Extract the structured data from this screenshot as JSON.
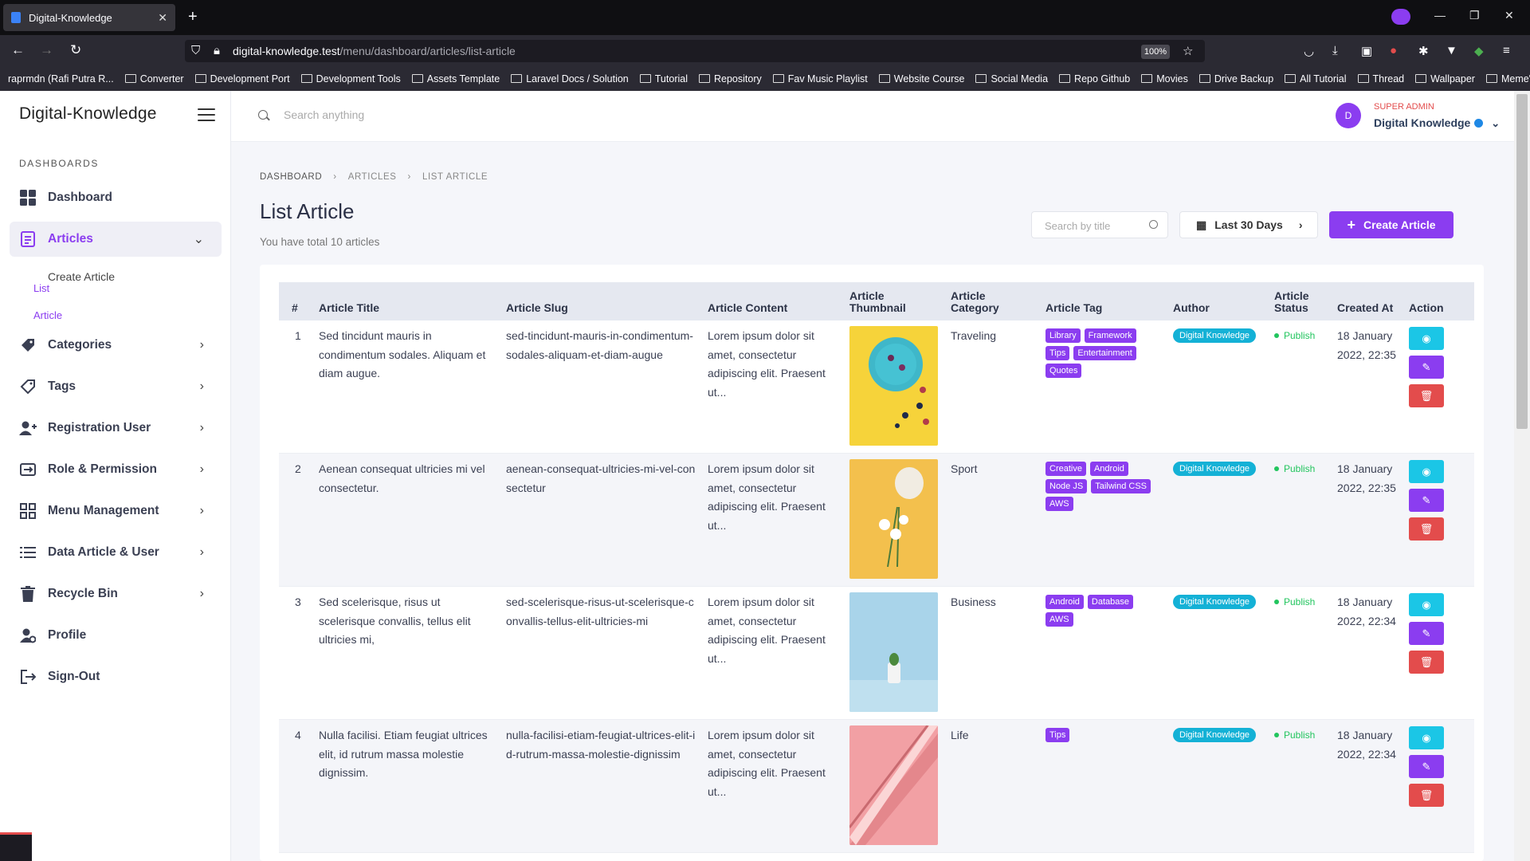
{
  "browser": {
    "tab_title": "Digital-Knowledge",
    "url_host": "digital-knowledge.test",
    "url_path": "/menu/dashboard/articles/list-article",
    "zoom": "100%",
    "bookmarks": [
      "raprmdn (Rafi Putra R...",
      "Converter",
      "Development Port",
      "Development Tools",
      "Assets Template",
      "Laravel Docs / Solution",
      "Tutorial",
      "Repository",
      "Fav Music Playlist",
      "Website Course",
      "Social Media",
      "Repo Github",
      "Movies",
      "Drive Backup",
      "All Tutorial",
      "Thread",
      "Wallpaper",
      "Meme's"
    ]
  },
  "sidebar": {
    "brand": "Digital-Knowledge",
    "section": "DASHBOARDS",
    "items": [
      {
        "label": "Dashboard"
      },
      {
        "label": "Articles",
        "sub": [
          "Create Article",
          "List Article"
        ]
      },
      {
        "label": "Categories"
      },
      {
        "label": "Tags"
      },
      {
        "label": "Registration User"
      },
      {
        "label": "Role & Permission"
      },
      {
        "label": "Menu Management"
      },
      {
        "label": "Data Article & User"
      },
      {
        "label": "Recycle Bin"
      },
      {
        "label": "Profile"
      },
      {
        "label": "Sign-Out"
      }
    ]
  },
  "topbar": {
    "search_placeholder": "Search anything",
    "avatar": "D",
    "role": "SUPER ADMIN",
    "user": "Digital Knowledge"
  },
  "page": {
    "breadcrumb": [
      "DASHBOARD",
      "ARTICLES",
      "LIST ARTICLE"
    ],
    "title": "List Article",
    "subtitle": "You have total 10 articles",
    "search_placeholder": "Search by title",
    "date_filter": "Last 30 Days",
    "create_label": "Create Article"
  },
  "table": {
    "headers": [
      "#",
      "Article Title",
      "Article Slug",
      "Article Content",
      "Article Thumbnail",
      "Article Category",
      "Article Tag",
      "Author",
      "Article Status",
      "Created At",
      "Action"
    ],
    "rows": [
      {
        "n": "1",
        "title": "Sed tincidunt mauris in condimentum sodales. Aliquam et diam augue.",
        "slug": "sed-tincidunt-mauris-in-condimentum-sodales-aliquam-et-diam-augue",
        "content": "Lorem ipsum dolor sit amet, consectetur adipiscing elit. Praesent ut...",
        "category": "Traveling",
        "tags": [
          "Library",
          "Framework",
          "Tips",
          "Entertainment",
          "Quotes"
        ],
        "author": "Digital Knowledge",
        "status": "Publish",
        "created": "18 January 2022, 22:35",
        "thumb": "yellow"
      },
      {
        "n": "2",
        "title": "Aenean consequat ultricies mi vel consectetur.",
        "slug": "aenean-consequat-ultricies-mi-vel-consectetur",
        "content": "Lorem ipsum dolor sit amet, consectetur adipiscing elit. Praesent ut...",
        "category": "Sport",
        "tags": [
          "Creative",
          "Android",
          "Node JS",
          "Tailwind CSS",
          "AWS"
        ],
        "author": "Digital Knowledge",
        "status": "Publish",
        "created": "18 January 2022, 22:35",
        "thumb": "gold"
      },
      {
        "n": "3",
        "title": "Sed scelerisque, risus ut scelerisque convallis, tellus elit ultricies mi,",
        "slug": "sed-scelerisque-risus-ut-scelerisque-convallis-tellus-elit-ultricies-mi",
        "content": "Lorem ipsum dolor sit amet, consectetur adipiscing elit. Praesent ut...",
        "category": "Business",
        "tags": [
          "Android",
          "Database",
          "AWS"
        ],
        "author": "Digital Knowledge",
        "status": "Publish",
        "created": "18 January 2022, 22:34",
        "thumb": "blue"
      },
      {
        "n": "4",
        "title": "Nulla facilisi. Etiam feugiat ultrices elit, id rutrum massa molestie dignissim.",
        "slug": "nulla-facilisi-etiam-feugiat-ultrices-elit-id-rutrum-massa-molestie-dignissim",
        "content": "Lorem ipsum dolor sit amet, consectetur adipiscing elit. Praesent ut...",
        "category": "Life",
        "tags": [
          "Tips"
        ],
        "author": "Digital Knowledge",
        "status": "Publish",
        "created": "18 January 2022, 22:34",
        "thumb": "pink"
      }
    ]
  },
  "colors": {
    "accent": "#8b3df0",
    "info": "#1bc6e6",
    "danger": "#e34c4c",
    "success": "#22c55e"
  }
}
